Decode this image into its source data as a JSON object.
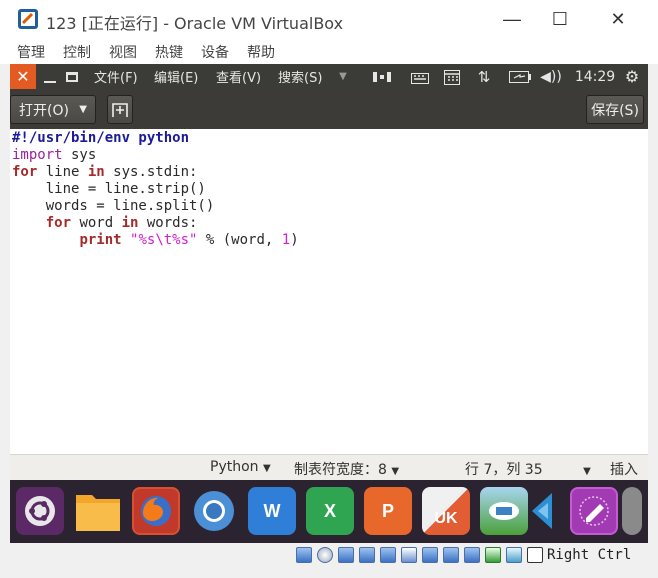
{
  "window": {
    "title": "123 [正在运行] - Oracle VM VirtualBox",
    "minimize": "—",
    "maximize": "☐",
    "close": "✕"
  },
  "menubar": [
    "管理",
    "控制",
    "视图",
    "热键",
    "设备",
    "帮助"
  ],
  "panel": {
    "close": "✕",
    "menus": [
      "文件(F)",
      "编辑(E)",
      "查看(V)",
      "搜索(S)"
    ],
    "time": "14:29"
  },
  "toolbar": {
    "open_label": "打开(O)",
    "save_label": "保存(S)"
  },
  "editor": {
    "lines": [
      [
        {
          "t": "#!/usr/bin/env python",
          "c": "sheb"
        }
      ],
      [
        {
          "t": "import",
          "c": "kw"
        },
        {
          "t": " sys",
          "c": ""
        }
      ],
      [
        {
          "t": "for",
          "c": "kwb"
        },
        {
          "t": " line ",
          "c": ""
        },
        {
          "t": "in",
          "c": "kwb"
        },
        {
          "t": " sys.stdin:",
          "c": ""
        }
      ],
      [
        {
          "t": "    line = line.strip()",
          "c": ""
        }
      ],
      [
        {
          "t": "    words = line.split()",
          "c": ""
        }
      ],
      [
        {
          "t": "    ",
          "c": ""
        },
        {
          "t": "for",
          "c": "kwb"
        },
        {
          "t": " word ",
          "c": ""
        },
        {
          "t": "in",
          "c": "kwb"
        },
        {
          "t": " words:",
          "c": ""
        }
      ],
      [
        {
          "t": "        ",
          "c": ""
        },
        {
          "t": "print",
          "c": "kwb"
        },
        {
          "t": " ",
          "c": ""
        },
        {
          "t": "\"%s\\t%s\"",
          "c": "str"
        },
        {
          "t": " % (word, ",
          "c": ""
        },
        {
          "t": "1",
          "c": "num"
        },
        {
          "t": ")",
          "c": ""
        }
      ]
    ]
  },
  "statusbar": {
    "language": "Python",
    "tab_width": "制表符宽度：8",
    "position": "行 7，列 35",
    "mode": "插入"
  },
  "dock": {
    "apps": [
      "ubuntu",
      "files",
      "firefox",
      "chromium",
      "wps-writer",
      "wps-spreadsheet",
      "wps-presentation",
      "ubuntu-software",
      "usb-creator",
      "vscode",
      "text-editor"
    ],
    "wps_writer_label": "W",
    "wps_sheet_label": "X",
    "wps_ppt_label": "P",
    "uk_label": "UK"
  },
  "vbox_status": {
    "host_key": "Right Ctrl"
  },
  "colors": {
    "panel": "#3b3b37",
    "close_accent": "#e35b23",
    "dock": "#2b2430"
  }
}
